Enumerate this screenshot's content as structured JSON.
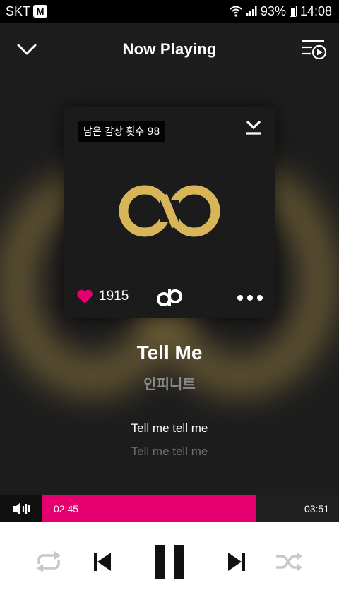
{
  "status_bar": {
    "carrier": "SKT",
    "carrier_badge": "M",
    "battery": "93%",
    "time": "14:08"
  },
  "header": {
    "title": "Now Playing",
    "icons": [
      "chevron-down-icon",
      "playlist-icon"
    ]
  },
  "album": {
    "play_count_label": "남은 감상 횟수 98",
    "like_count": "1915",
    "icons": [
      "download-icon",
      "heart-icon",
      "brand-logo-icon",
      "more-icon"
    ]
  },
  "track": {
    "title": "Tell Me",
    "artist": "인피니트"
  },
  "lyrics": {
    "current": "Tell me tell me",
    "next": "Tell me tell me"
  },
  "playback": {
    "elapsed": "02:45",
    "total": "03:51",
    "progress_fraction": 0.72
  },
  "controls": {
    "icons": [
      "repeat-icon",
      "previous-icon",
      "pause-icon",
      "next-icon",
      "shuffle-icon"
    ]
  },
  "colors": {
    "accent": "#e6006f",
    "gold": "#d9b55a",
    "background": "#1d1d1d"
  }
}
